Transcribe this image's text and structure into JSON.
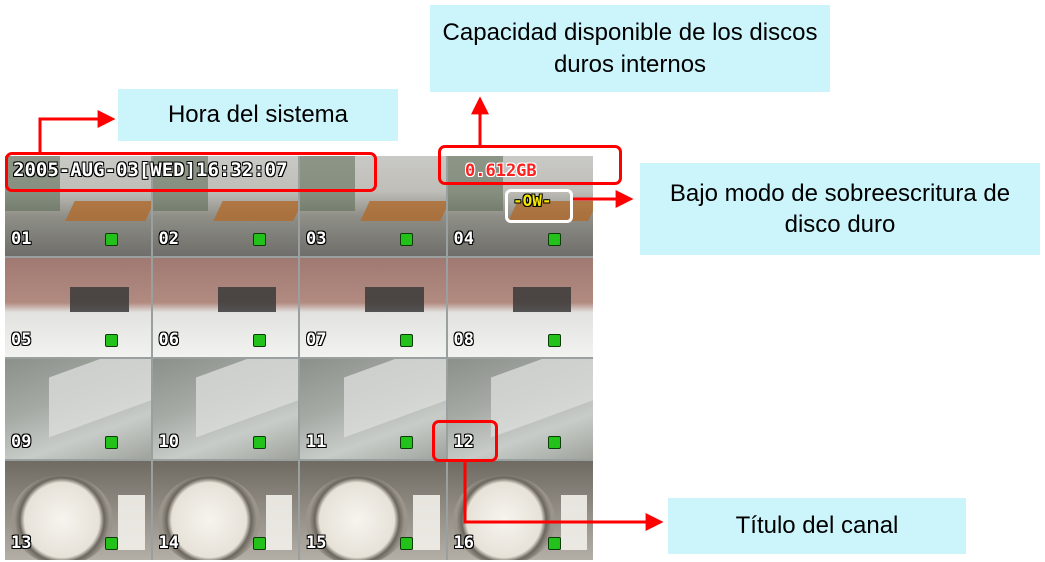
{
  "callouts": {
    "capacity": "Capacidad disponible de los discos duros internos",
    "system_time": "Hora del sistema",
    "overwrite_mode": "Bajo modo de sobreescritura de disco duro",
    "channel_title": "Título del canal"
  },
  "dvr": {
    "timestamp": "2005-AUG-03[WED]16:32:07",
    "capacity": "0.612GB",
    "overwrite_flag": "-OW-",
    "channels": [
      "01",
      "02",
      "03",
      "04",
      "05",
      "06",
      "07",
      "08",
      "09",
      "10",
      "11",
      "12",
      "13",
      "14",
      "15",
      "16"
    ]
  },
  "colors": {
    "callout_bg": "#ccf5fb",
    "highlight": "#ff0000",
    "status_dot": "#22c21a"
  }
}
